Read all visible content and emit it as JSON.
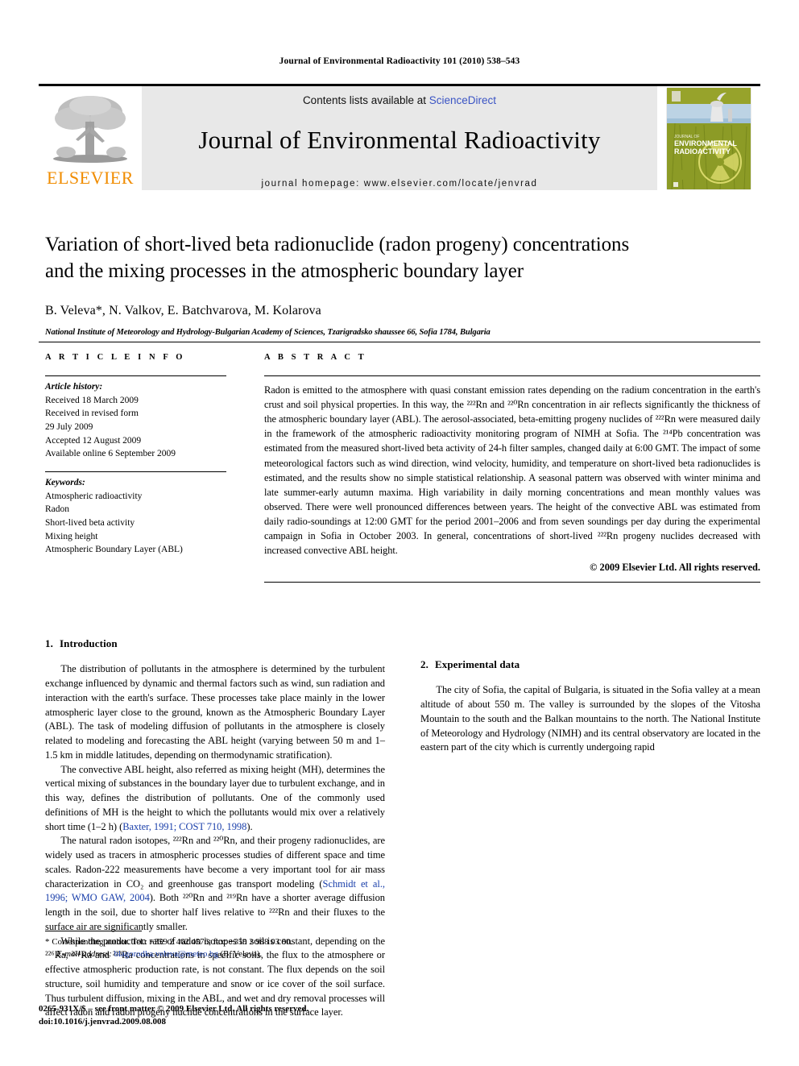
{
  "running_head": "Journal of Environmental Radioactivity 101 (2010) 538–543",
  "masthead": {
    "publisher_name": "ELSEVIER",
    "contents_prefix": "Contents lists available at ",
    "sciencedirect": "ScienceDirect",
    "journal_title": "Journal of Environmental Radioactivity",
    "homepage_label": "journal homepage: www.elsevier.com/locate/jenvrad",
    "cover_title_line1": "JOURNAL OF",
    "cover_title_line2": "ENVIRONMENTAL",
    "cover_title_line3": "RADIOACTIVITY",
    "link_color": "#3a54c4",
    "elsevier_orange": "#F08C00",
    "masthead_bg": "#e8e8e8"
  },
  "article": {
    "title_line1": "Variation of short-lived beta radionuclide (radon progeny) concentrations",
    "title_line2": "and the mixing processes in the atmospheric boundary layer",
    "authors": "B. Veleva*, N. Valkov, E. Batchvarova, M. Kolarova",
    "affiliation": "National Institute of Meteorology and Hydrology-Bulgarian Academy of Sciences, Tzarigradsko shaussee 66, Sofia 1784, Bulgaria"
  },
  "headings": {
    "article_info": "A R T I C L E   I N F O",
    "abstract": "A B S T R A C T"
  },
  "article_info": {
    "history_label": "Article history:",
    "history": [
      "Received 18 March 2009",
      "Received in revised form",
      "29 July 2009",
      "Accepted 12 August 2009",
      "Available online 6 September 2009"
    ],
    "keywords_label": "Keywords:",
    "keywords": [
      "Atmospheric radioactivity",
      "Radon",
      "Short-lived beta activity",
      "Mixing height",
      "Atmospheric Boundary Layer (ABL)"
    ]
  },
  "abstract": {
    "text": "Radon is emitted to the atmosphere with quasi constant emission rates depending on the radium concentration in the earth's crust and soil physical properties. In this way, the ²²²Rn and ²²⁰Rn concentration in air reflects significantly the thickness of the atmospheric boundary layer (ABL). The aerosol-associated, beta-emitting progeny nuclides of ²²²Rn were measured daily in the framework of the atmospheric radioactivity monitoring program of NIMH at Sofia. The ²¹⁴Pb concentration was estimated from the measured short-lived beta activity of 24-h filter samples, changed daily at 6:00 GMT. The impact of some meteorological factors such as wind direction, wind velocity, humidity, and temperature on short-lived beta radionuclides is estimated, and the results show no simple statistical relationship. A seasonal pattern was observed with winter minima and late summer-early autumn maxima. High variability in daily morning concentrations and mean monthly values was observed. There were well pronounced differences between years. The height of the convective ABL was estimated from daily radio-soundings at 12:00 GMT for the period 2001–2006 and from seven soundings per day during the experimental campaign in Sofia in October 2003. In general, concentrations of short-lived ²²²Rn progeny nuclides decreased with increased convective ABL height.",
    "copyright": "© 2009 Elsevier Ltd. All rights reserved."
  },
  "sections": {
    "intro_num": "1.",
    "intro_title": "Introduction",
    "intro_p1": "The distribution of pollutants in the atmosphere is determined by the turbulent exchange influenced by dynamic and thermal factors such as wind, sun radiation and interaction with the earth's surface. These processes take place mainly in the lower atmospheric layer close to the ground, known as the Atmospheric Boundary Layer (ABL). The task of modeling diffusion of pollutants in the atmosphere is closely related to modeling and forecasting the ABL height (varying between 50 m and 1–1.5 km in middle latitudes, depending on thermodynamic stratification).",
    "intro_p2_a": "The convective ABL height, also referred as mixing height (MH), determines the vertical mixing of substances in the boundary layer due to turbulent exchange, and in this way, defines the distribution of pollutants. One of the commonly used definitions of MH is the height to which the pollutants would mix over a relatively short time (1–2 h) (",
    "intro_p2_ref": "Baxter, 1991; COST 710, 1998",
    "intro_p2_b": ").",
    "intro_p3": "The natural radon isotopes, ²²²Rn and ²²⁰Rn, and their progeny radionuclides, are widely used as tracers in atmospheric processes studies of different space and time scales. Radon-222 measurements have become a very important tool for air mass characterization in CO₂ and greenhouse gas transport modeling (",
    "intro_p3_ref": "Schmidt et al., 1996; WMO GAW, 2004",
    "intro_p3_b": "). Both ²²⁰Rn and ²¹⁹Rn have a shorter average diffusion length in the soil, due to shorter half lives relative to ²²²Rn and their fluxes to the surface air are significantly smaller.",
    "intro_p4": "While the production rate of radon isotopes in soil is constant, depending on the ²²⁶Ra, ²²⁴Ra and ²²³Ra concentrations in specific soils, the flux to the atmosphere or effective atmospheric production rate, is not constant. The flux depends on the soil structure, soil humidity and temperature and snow or ice cover of the soil surface. Thus turbulent diffusion, mixing in the ABL, and wet and dry removal processes will affect radon and radon progeny nuclide concentrations in the surface layer.",
    "exp_num": "2.",
    "exp_title": "Experimental data",
    "exp_p1": "The city of Sofia, the capital of Bulgaria, is situated in the Sofia valley at a mean altitude of about 550 m. The valley is surrounded by the slopes of the Vitosha Mountain to the south and the Balkan mountains to the north. The National Institute of Meteorology and Hydrology (NIMH) and its central observatory are located in the eastern part of the city which is currently undergoing rapid"
  },
  "footnote": {
    "star": "*",
    "corresponding": "Corresponding author. Tel.: +359 2 462 4576; fax: +359 2 988 03 80.",
    "email_label": "E-mail address:",
    "email": "blagorodka.veleva@meteo.bg",
    "email_suffix": "(B. Veleva)."
  },
  "imprint": {
    "line1": "0265-931X/$ – see front matter © 2009 Elsevier Ltd. All rights reserved.",
    "line2": "doi:10.1016/j.jenvrad.2009.08.008"
  }
}
